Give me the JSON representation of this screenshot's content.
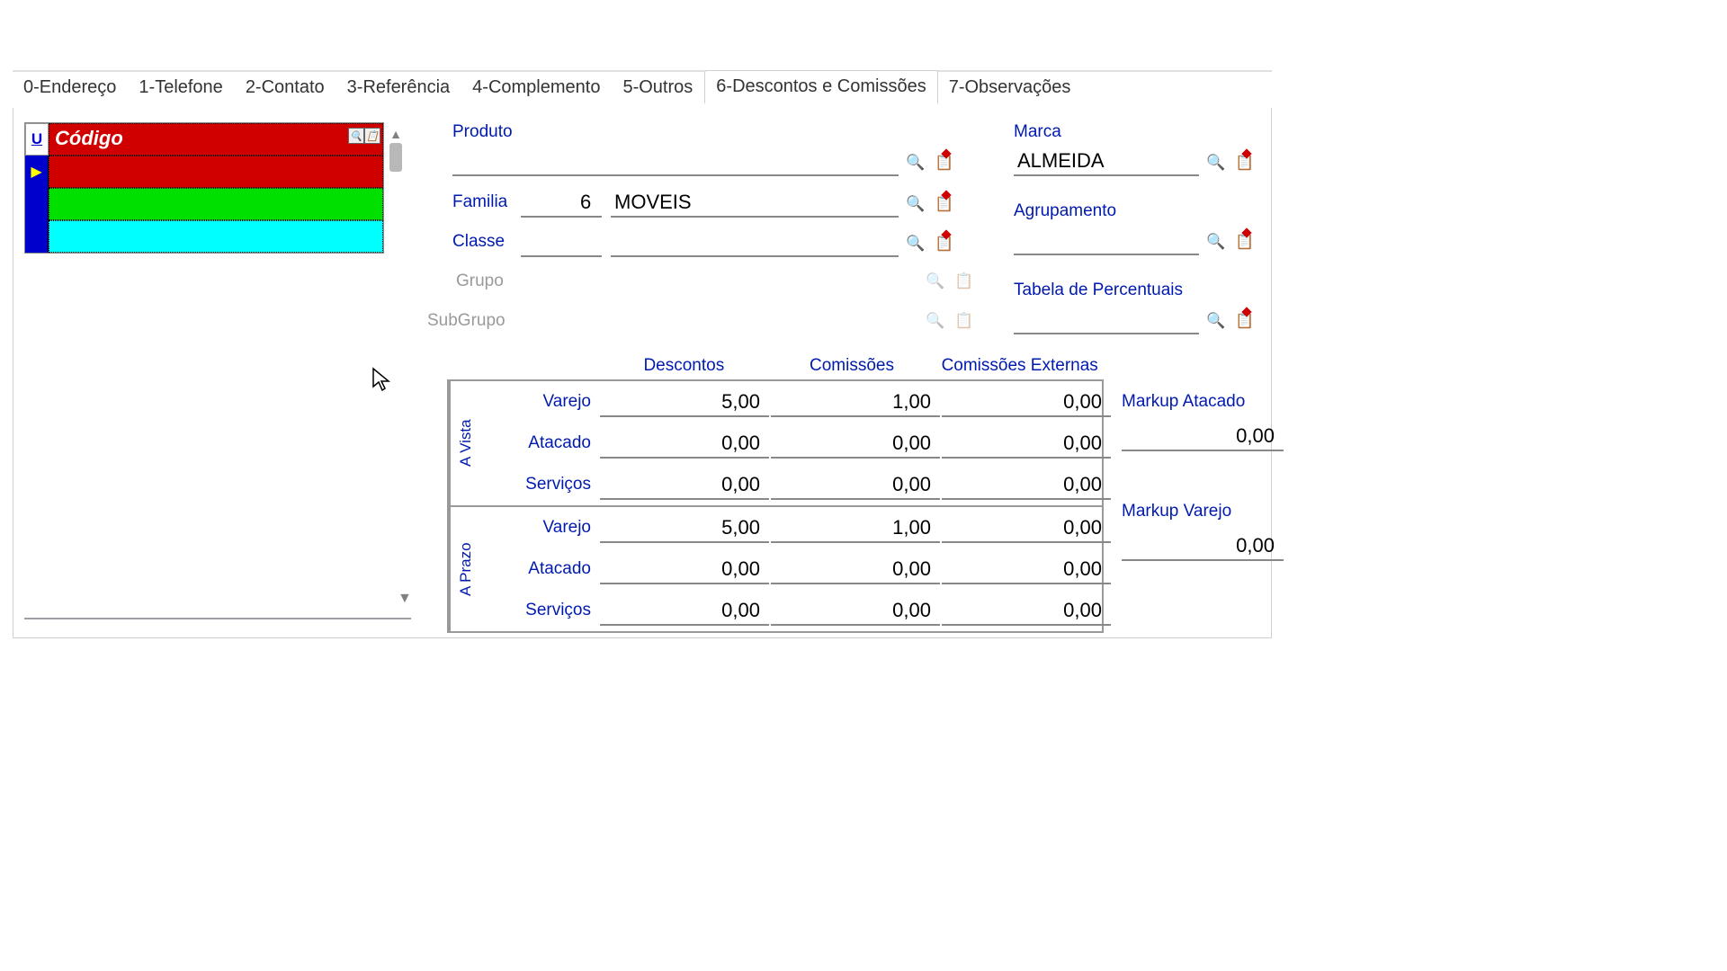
{
  "tabs": {
    "endereco": "0-Endereço",
    "telefone": "1-Telefone",
    "contato": "2-Contato",
    "referencia": "3-Referência",
    "complemento": "4-Complemento",
    "outros": "5-Outros",
    "descontos": "6-Descontos e Comissões",
    "observacoes": "7-Observações"
  },
  "grid": {
    "gutter_mark": "U",
    "col_header": "Código"
  },
  "form": {
    "produto_label": "Produto",
    "produto_value": "",
    "familia_label": "Familia",
    "familia_code": "6",
    "familia_value": "MOVEIS",
    "classe_label": "Classe",
    "classe_value": "",
    "grupo_label": "Grupo",
    "subgrupo_label": "SubGrupo",
    "marca_label": "Marca",
    "marca_value": "ALMEIDA",
    "agrupamento_label": "Agrupamento",
    "agrupamento_value": "",
    "tabela_label": "Tabela de Percentuais",
    "tabela_value": ""
  },
  "table": {
    "headers": {
      "descontos": "Descontos",
      "comissoes": "Comissões",
      "comissoes_ext": "Comissões Externas"
    },
    "row_labels": {
      "varejo": "Varejo",
      "atacado": "Atacado",
      "servicos": "Serviços"
    },
    "group_labels": {
      "avista": "A Vista",
      "aprazo": "A Prazo"
    },
    "avista": {
      "varejo": {
        "d": "5,00",
        "c": "1,00",
        "ce": "0,00"
      },
      "atacado": {
        "d": "0,00",
        "c": "0,00",
        "ce": "0,00"
      },
      "servicos": {
        "d": "0,00",
        "c": "0,00",
        "ce": "0,00"
      }
    },
    "aprazo": {
      "varejo": {
        "d": "5,00",
        "c": "1,00",
        "ce": "0,00"
      },
      "atacado": {
        "d": "0,00",
        "c": "0,00",
        "ce": "0,00"
      },
      "servicos": {
        "d": "0,00",
        "c": "0,00",
        "ce": "0,00"
      }
    }
  },
  "markup": {
    "atacado_label": "Markup Atacado",
    "atacado_value": "0,00",
    "varejo_label": "Markup Varejo",
    "varejo_value": "0,00"
  }
}
